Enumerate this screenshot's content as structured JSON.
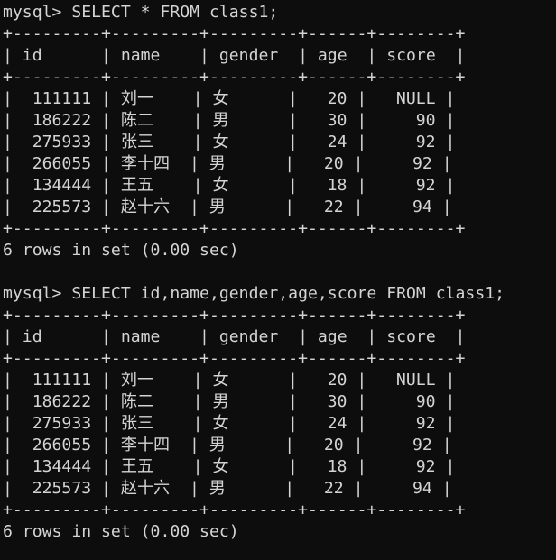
{
  "terminal": {
    "prompt": "mysql> ",
    "background_color": "#0d0d0d",
    "text_color": "#d4d4d4"
  },
  "columns": [
    {
      "name": "id",
      "width": 9,
      "align": "right"
    },
    {
      "name": "name",
      "width": 9,
      "align": "left"
    },
    {
      "name": "gender",
      "width": 9,
      "align": "left"
    },
    {
      "name": "age",
      "width": 6,
      "align": "right"
    },
    {
      "name": "score",
      "width": 8,
      "align": "right"
    }
  ],
  "rows": [
    {
      "id": "111111",
      "name": "刘一",
      "gender": "女",
      "age": "20",
      "score": "NULL"
    },
    {
      "id": "186222",
      "name": "陈二",
      "gender": "男",
      "age": "30",
      "score": "90"
    },
    {
      "id": "275933",
      "name": "张三",
      "gender": "女",
      "age": "24",
      "score": "92"
    },
    {
      "id": "266055",
      "name": "李十四",
      "gender": "男",
      "age": "20",
      "score": "92"
    },
    {
      "id": "134444",
      "name": "王五",
      "gender": "女",
      "age": "18",
      "score": "92"
    },
    {
      "id": "225573",
      "name": "赵十六",
      "gender": "男",
      "age": "22",
      "score": "94"
    }
  ],
  "blocks": [
    {
      "command": "SELECT * FROM class1;",
      "status": "6 rows in set (0.00 sec)"
    },
    {
      "command": "SELECT id,name,gender,age,score FROM class1;",
      "status": "6 rows in set (0.00 sec)"
    }
  ]
}
